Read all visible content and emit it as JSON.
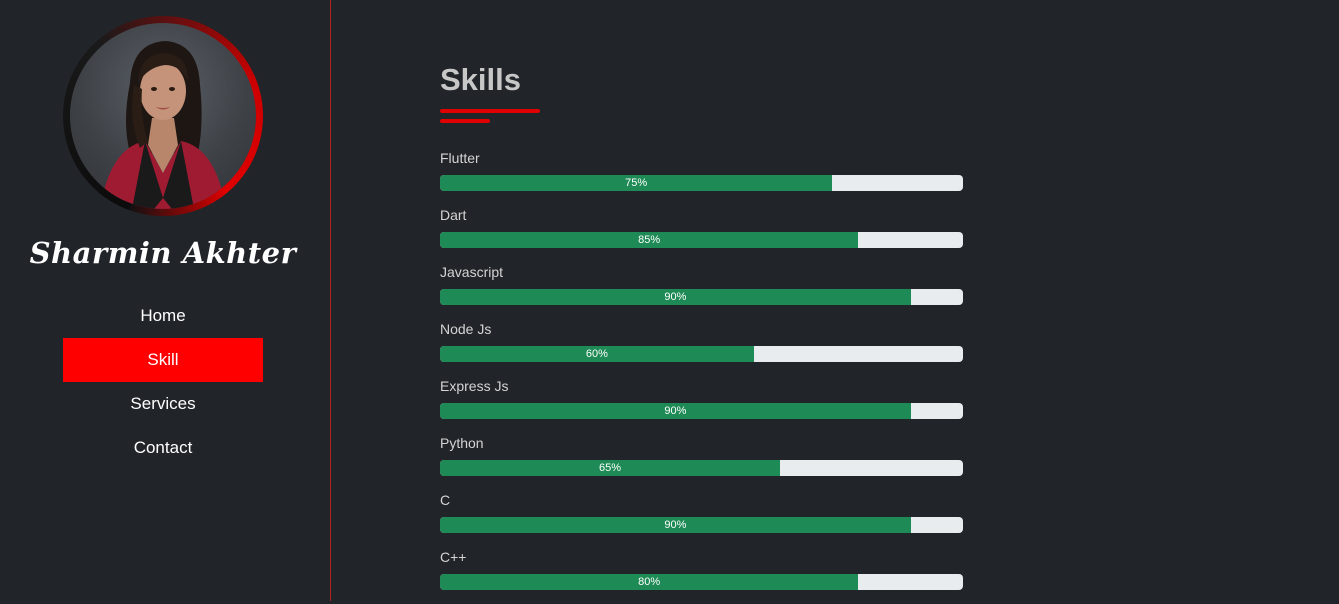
{
  "profile": {
    "name": "Sharmin Akhter"
  },
  "nav": {
    "items": [
      {
        "label": "Home",
        "active": false
      },
      {
        "label": "Skill",
        "active": true
      },
      {
        "label": "Services",
        "active": false
      },
      {
        "label": "Contact",
        "active": false
      }
    ]
  },
  "colors": {
    "accent": "#ff0000",
    "bar_fill": "#1e8a55",
    "bar_track": "#e9ecef",
    "background": "#212429"
  },
  "section": {
    "title": "Skills"
  },
  "skills": [
    {
      "name": "Flutter",
      "percent": 75,
      "label": "75%"
    },
    {
      "name": "Dart",
      "percent": 80,
      "label": "85%"
    },
    {
      "name": "Javascript",
      "percent": 90,
      "label": "90%"
    },
    {
      "name": "Node Js",
      "percent": 60,
      "label": "60%"
    },
    {
      "name": "Express Js",
      "percent": 90,
      "label": "90%"
    },
    {
      "name": "Python",
      "percent": 65,
      "label": "65%"
    },
    {
      "name": "C",
      "percent": 90,
      "label": "90%"
    },
    {
      "name": "C++",
      "percent": 80,
      "label": "80%"
    }
  ]
}
